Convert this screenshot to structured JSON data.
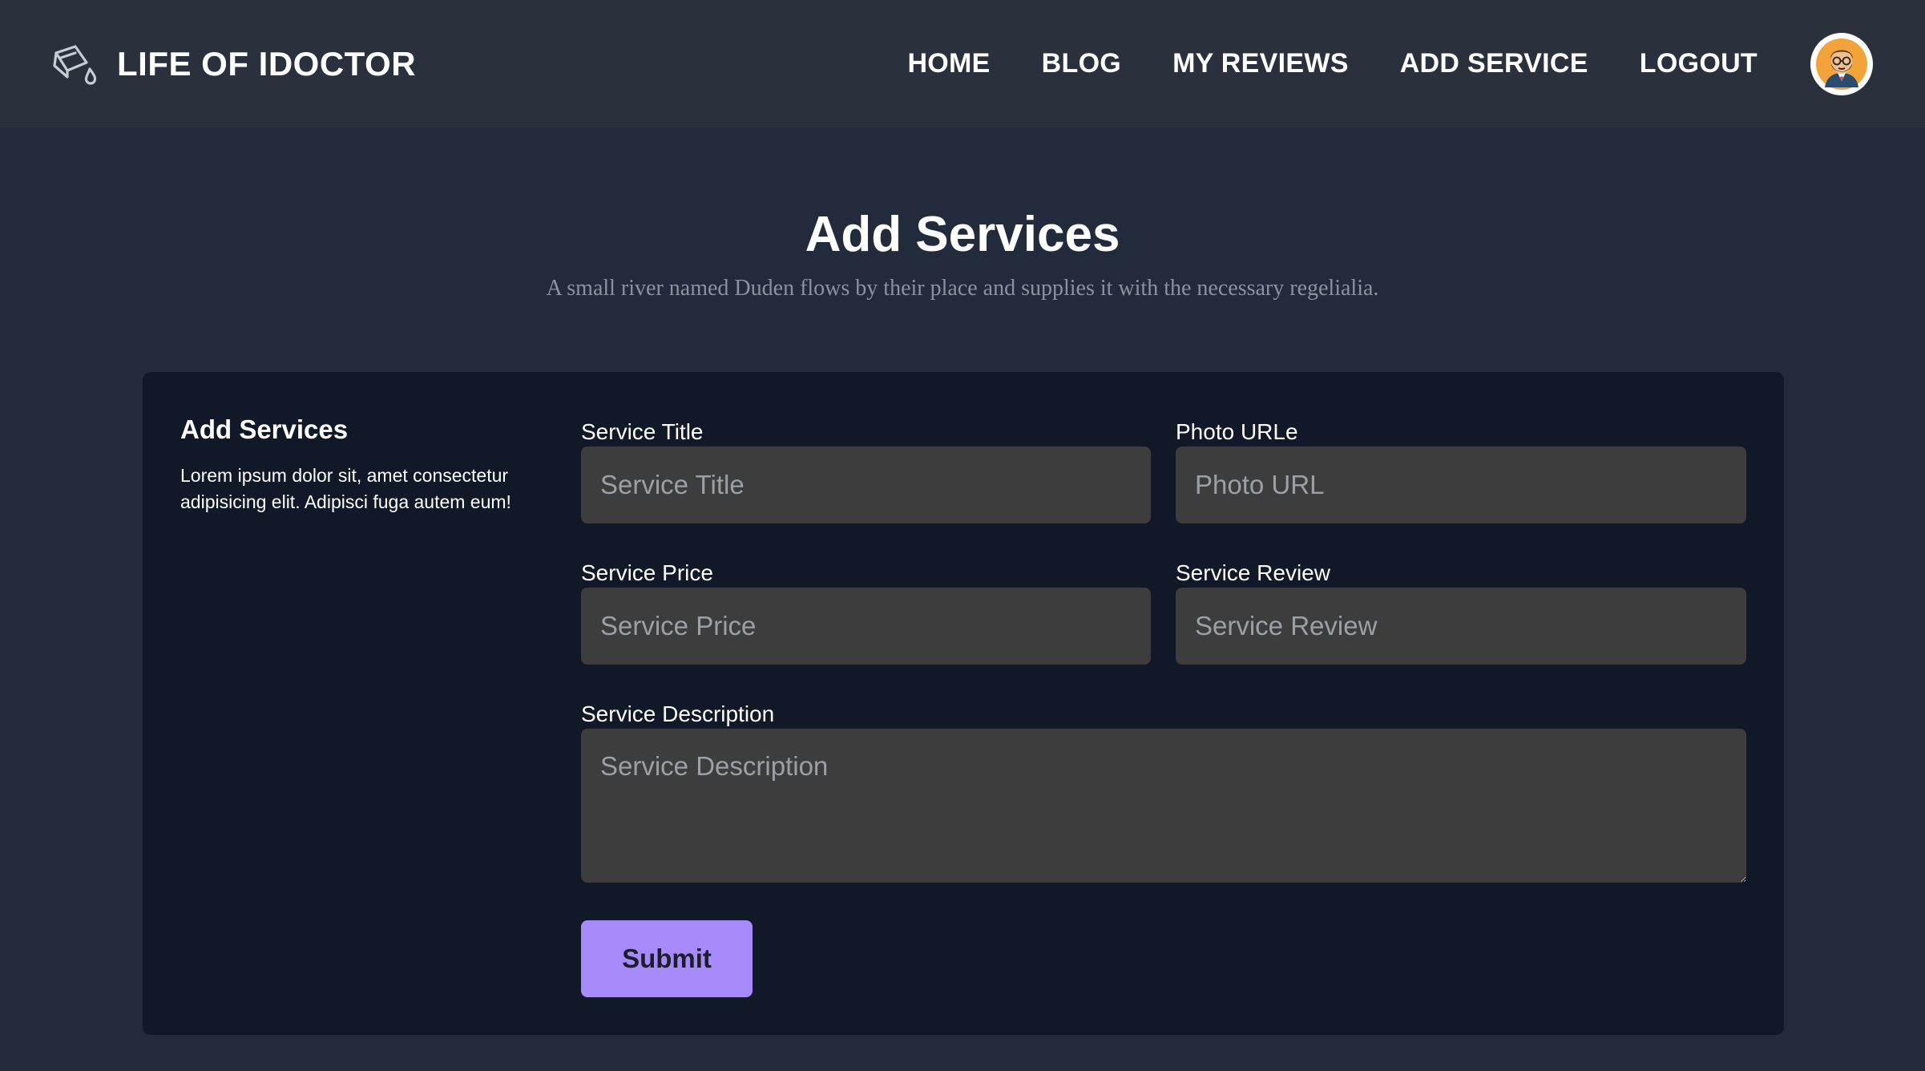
{
  "brand": {
    "name": "LIFE OF IDOCTOR",
    "icon": "bucket-drop-icon"
  },
  "nav": {
    "items": [
      {
        "label": "HOME"
      },
      {
        "label": "BLOG"
      },
      {
        "label": "MY REVIEWS"
      },
      {
        "label": "ADD SERVICE"
      },
      {
        "label": "LOGOUT"
      }
    ],
    "avatar_icon": "user-avatar-icon"
  },
  "hero": {
    "title": "Add Services",
    "subtitle": "A small river named Duden flows by their place and supplies it with the necessary regelialia."
  },
  "form": {
    "side_title": "Add Services",
    "side_text": "Lorem ipsum dolor sit, amet consectetur adipisicing elit. Adipisci fuga autem eum!",
    "fields": {
      "service_title": {
        "label": "Service Title",
        "placeholder": "Service Title",
        "value": ""
      },
      "photo_url": {
        "label": "Photo URLe",
        "placeholder": "Photo URL",
        "value": ""
      },
      "service_price": {
        "label": "Service Price",
        "placeholder": "Service Price",
        "value": ""
      },
      "service_review": {
        "label": "Service Review",
        "placeholder": "Service Review",
        "value": ""
      },
      "service_description": {
        "label": "Service Description",
        "placeholder": "Service Description",
        "value": ""
      }
    },
    "submit_label": "Submit"
  },
  "colors": {
    "page_bg": "#222b3b",
    "navbar_bg": "#2a303c",
    "card_bg": "#111827",
    "input_bg": "#3d3d3d",
    "accent": "#a78bfa",
    "muted_text": "#8c939f"
  }
}
